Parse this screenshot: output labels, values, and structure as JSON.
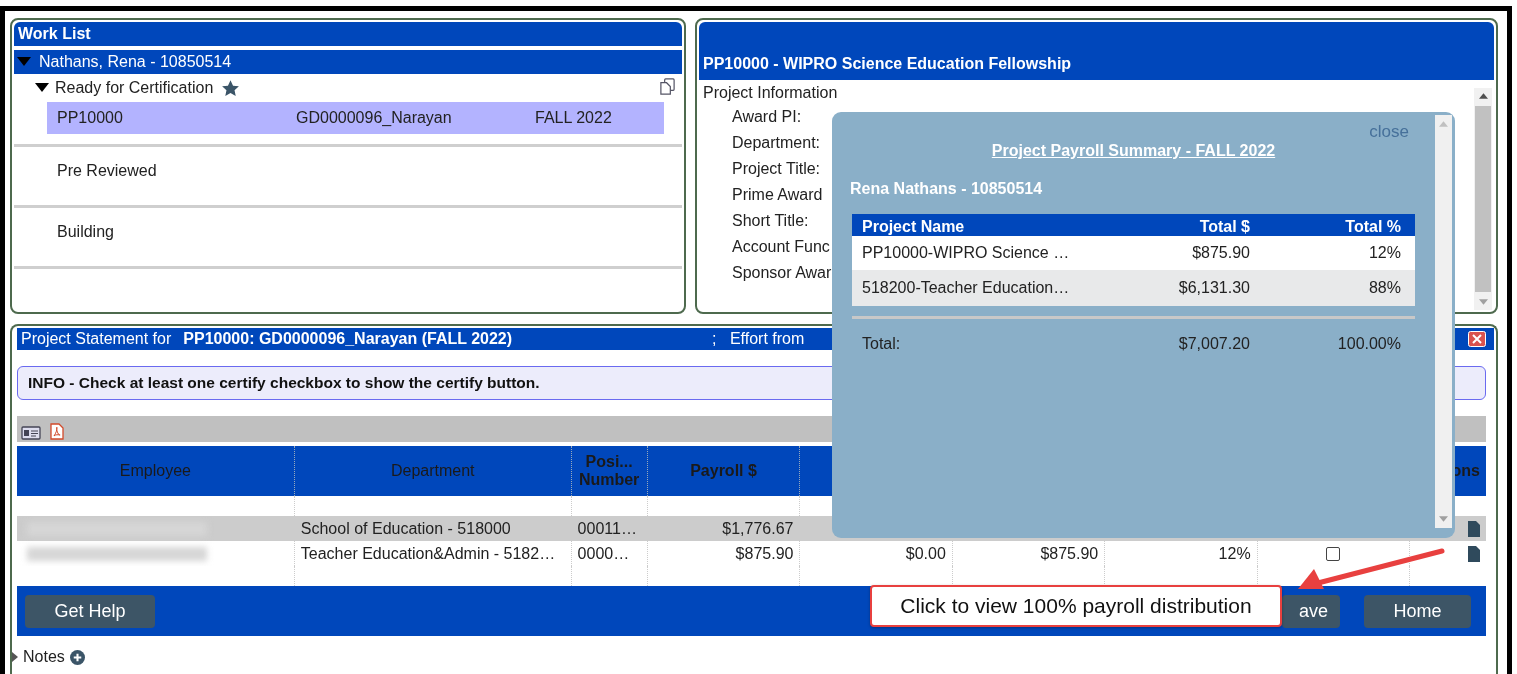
{
  "work_list": {
    "title": "Work List",
    "person": {
      "label": "Nathans, Rena - 10850514",
      "expanded": true
    },
    "groups": [
      {
        "label": "Ready for Certification",
        "expanded": true,
        "starred": true,
        "items": [
          {
            "project": "PP10000",
            "grant": "GD0000096_Narayan",
            "term": "FALL 2022",
            "selected": true
          }
        ]
      },
      {
        "label": "Pre Reviewed"
      },
      {
        "label": "Building"
      }
    ]
  },
  "project_info": {
    "title": "PP10000 - WIPRO Science Education Fellowship",
    "section": "Project Information",
    "fields": [
      "Award PI:",
      "Department:",
      "Project Title:",
      "Prime Award",
      "Short Title:",
      "Account Func",
      "Sponsor Awar"
    ]
  },
  "statement": {
    "label": "Project Statement for",
    "project": "PP10000: GD0000096_Narayan (FALL 2022)",
    "effort": ";   Effort from",
    "info": "INFO - Check at least one certify checkbox to show the certify button.",
    "columns": {
      "employee": "Employee",
      "department": "Department",
      "position": "Posi... Number",
      "payroll": "Payroll $",
      "actions": "ons"
    },
    "rows": [
      {
        "selected": true,
        "department": "School of Education - 518000",
        "position": "00011…",
        "payroll": "$1,776.67"
      },
      {
        "selected": false,
        "department": "Teacher Education&Admin - 5182…",
        "position": "0000…",
        "payroll": "$875.90",
        "column_5": "$0.00",
        "column_6": "$875.90",
        "column_7": "12%",
        "certify": {
          "checked": false
        }
      }
    ],
    "buttons": [
      "Get Help",
      "ave",
      "Home"
    ]
  },
  "notes": {
    "label": "Notes",
    "expanded": false
  },
  "popup": {
    "close": "close",
    "title": "Project Payroll Summary - FALL 2022",
    "person": "Rena Nathans - 10850514",
    "columns": [
      "Project Name",
      "Total $",
      "Total %"
    ],
    "rows": [
      {
        "name": "PP10000-WIPRO Science …",
        "total": "$875.90",
        "percent": "12%"
      },
      {
        "name": "518200-Teacher Education…",
        "total": "$6,131.30",
        "percent": "88%"
      }
    ],
    "total": {
      "label": "Total:",
      "total": "$7,007.20",
      "percent": "100.00%"
    }
  },
  "callout": {
    "text": "Click to view 100% payroll distribution"
  }
}
